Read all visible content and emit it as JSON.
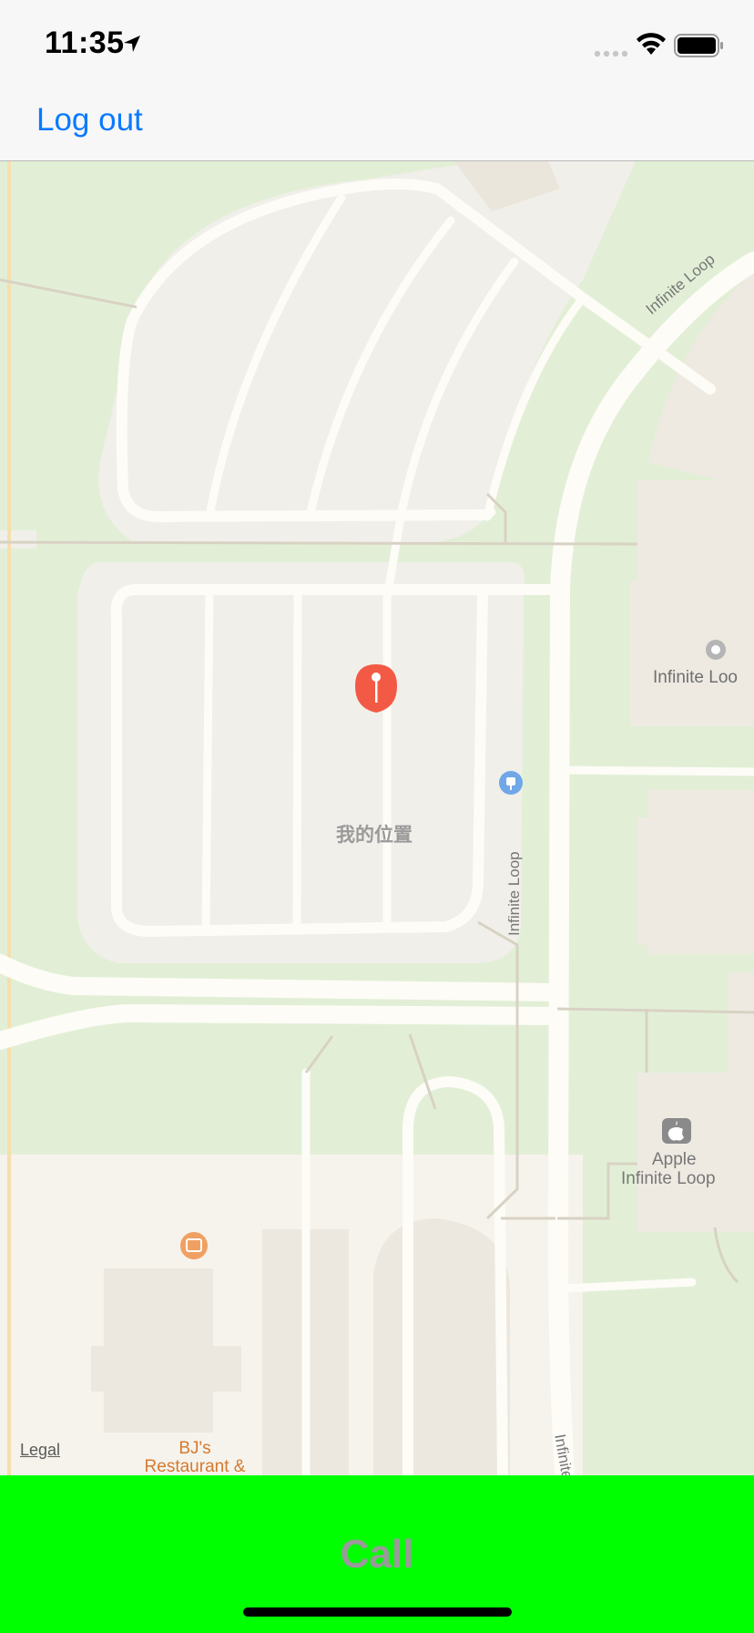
{
  "status_bar": {
    "time": "11:35",
    "icons": [
      "location-arrow-icon",
      "cellular-signal-icon",
      "wifi-icon",
      "battery-icon"
    ]
  },
  "nav": {
    "logout_label": "Log out"
  },
  "map": {
    "user_pin_label": "我的位置",
    "labels": {
      "infinite_loop_top": "Infinite Loop",
      "infinite_loop_poi": "Infinite Loo",
      "infinite_loop_vertical": "Infinite Loop",
      "infinite_loop_bottom": "Infinite",
      "apple_poi_line1": "Apple",
      "apple_poi_line2": "Infinite Loop",
      "bj_line1": "BJ's",
      "bj_line2": "Restaurant &"
    },
    "legal": "Legal",
    "colors": {
      "park": "#e2efd6",
      "land": "#f1efea",
      "road": "#fdfcf7",
      "pin": "#f25a45",
      "ev_charger": "#6fa7e8",
      "restaurant": "#f0a062"
    }
  },
  "call": {
    "label": "Call",
    "background": "#00ff00"
  }
}
